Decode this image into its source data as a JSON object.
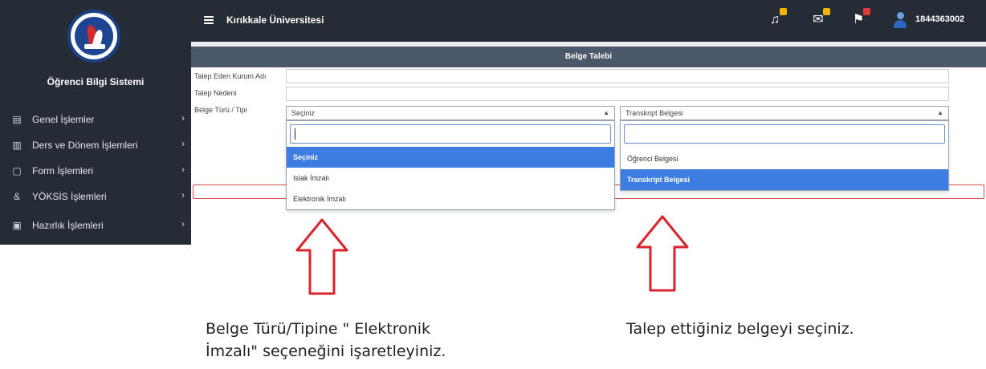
{
  "sidebar": {
    "title": "Öğrenci Bilgi Sistemi",
    "items": [
      {
        "label": "Genel İşlemler",
        "icon": "card-icon"
      },
      {
        "label": "Ders ve Dönem İşlemleri",
        "icon": "book-icon"
      },
      {
        "label": "Form İşlemleri",
        "icon": "form-icon"
      },
      {
        "label": "YÖKSİS İşlemleri",
        "icon": "link-icon"
      },
      {
        "label": "Hazırlık İşlemleri",
        "icon": "prep-icon"
      }
    ]
  },
  "topbar": {
    "brand": "Kırıkkale Üniversitesi",
    "user_id": "1844363002",
    "colors": {
      "bell_badge": "#f4b400",
      "mail_badge": "#f4b400",
      "flag_badge": "#e53935"
    }
  },
  "panel": {
    "title": "Belge Talebi",
    "labels": {
      "institution": "Talep Eden Kurum Adı",
      "reason": "Talep Nedeni",
      "doc_type": "Belge Türü / Tipi"
    },
    "type_select": {
      "value": "Seçiniz",
      "options": [
        "Seçiniz",
        "Islak İmzalı",
        "Elektronik İmzalı"
      ],
      "highlighted": "Seçiniz"
    },
    "doc_select": {
      "value": "Transkript Belgesi",
      "options": [
        "Öğrenci Belgesi",
        "Transkript Belgesi"
      ],
      "highlighted": "Transkript Belgesi"
    }
  },
  "annotations": {
    "left_line1": "Belge Türü/Tipine \" Elektronik",
    "left_line2": "İmzalı\" seçeneğini işaretleyiniz.",
    "right": "Talep ettiğiniz belgeyi seçiniz.",
    "arrow_color": "#d9232d"
  }
}
